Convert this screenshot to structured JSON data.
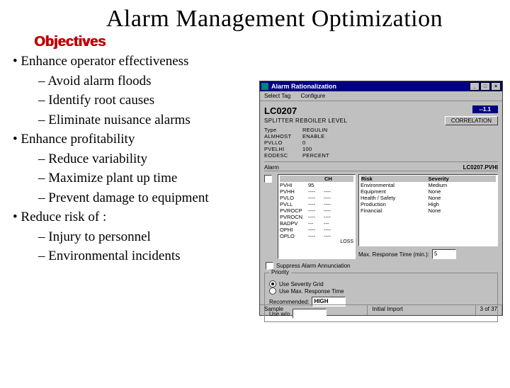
{
  "title": "Alarm Management Optimization",
  "objectives_label": "Objectives",
  "bullets": [
    {
      "text": "Enhance operator effectiveness",
      "level": 1
    },
    {
      "text": "Avoid alarm floods",
      "level": 2
    },
    {
      "text": "Identify root causes",
      "level": 2
    },
    {
      "text": "Eliminate nuisance alarms",
      "level": 2
    },
    {
      "text": "Enhance profitability",
      "level": 1
    },
    {
      "text": "Reduce variability",
      "level": 2
    },
    {
      "text": "Maximize plant up time",
      "level": 2
    },
    {
      "text": "Prevent damage to equipment",
      "level": 2
    },
    {
      "text": "Reduce risk of :",
      "level": 1
    },
    {
      "text": "Injury to personnel",
      "level": 2
    },
    {
      "text": "Environmental incidents",
      "level": 2
    }
  ],
  "app": {
    "titlebar": "Alarm Rationalization",
    "menu": {
      "select_tag": "Select Tag",
      "configure": "Configure"
    },
    "tag": "LC0207",
    "description": "SPLITTER REBOILER LEVEL",
    "header_right_badge": "--1.1",
    "header_right_button": "CORRELATION",
    "params": {
      "Type": "REGULIN",
      "ALMHOST": "ENABLE",
      "PVLLO": "0",
      "PVELHI": "100",
      "EODESC": "PERCENT"
    },
    "alarm_label": "Alarm",
    "pv_point": "LC0207.PVHI",
    "alarm_table": {
      "headers": [
        "",
        "",
        "CH"
      ],
      "rows": [
        [
          "PVHI",
          "95",
          ""
        ],
        [
          "PVHH",
          "----",
          "----"
        ],
        [
          "PVLO",
          "----",
          "----"
        ],
        [
          "PVLL",
          "----",
          "----"
        ],
        [
          "PVROCP",
          "----",
          "----"
        ],
        [
          "PVROCN",
          "----",
          "----"
        ],
        [
          "BADPV",
          "---",
          "---"
        ],
        [
          "OPHI",
          "----",
          "----"
        ],
        [
          "OPLO",
          "----",
          "----"
        ]
      ],
      "footer": "LOSS"
    },
    "right_table": {
      "headers": [
        "Risk",
        "Severity"
      ],
      "rows": [
        [
          "Environmental",
          "Medium"
        ],
        [
          "Equipment",
          "None"
        ],
        [
          "Health / Safety",
          "None"
        ],
        [
          "Production",
          "High"
        ],
        [
          "Financial",
          "None"
        ]
      ]
    },
    "suppress_label": "Suppress Alarm Annunciation",
    "max_rt_label": "Max. Response Time (min.):",
    "max_rt_value": "5",
    "priority_box": {
      "title": "Priority",
      "opt1": "Use Severity Grid",
      "opt2": "Use Max. Response Time",
      "rec_label": "Recommended:",
      "rec_value": "HIGH",
      "use_label": "Use w/o"
    },
    "status": {
      "left": "Sample",
      "mid": "Initial Import",
      "right": "3 of 37"
    }
  }
}
